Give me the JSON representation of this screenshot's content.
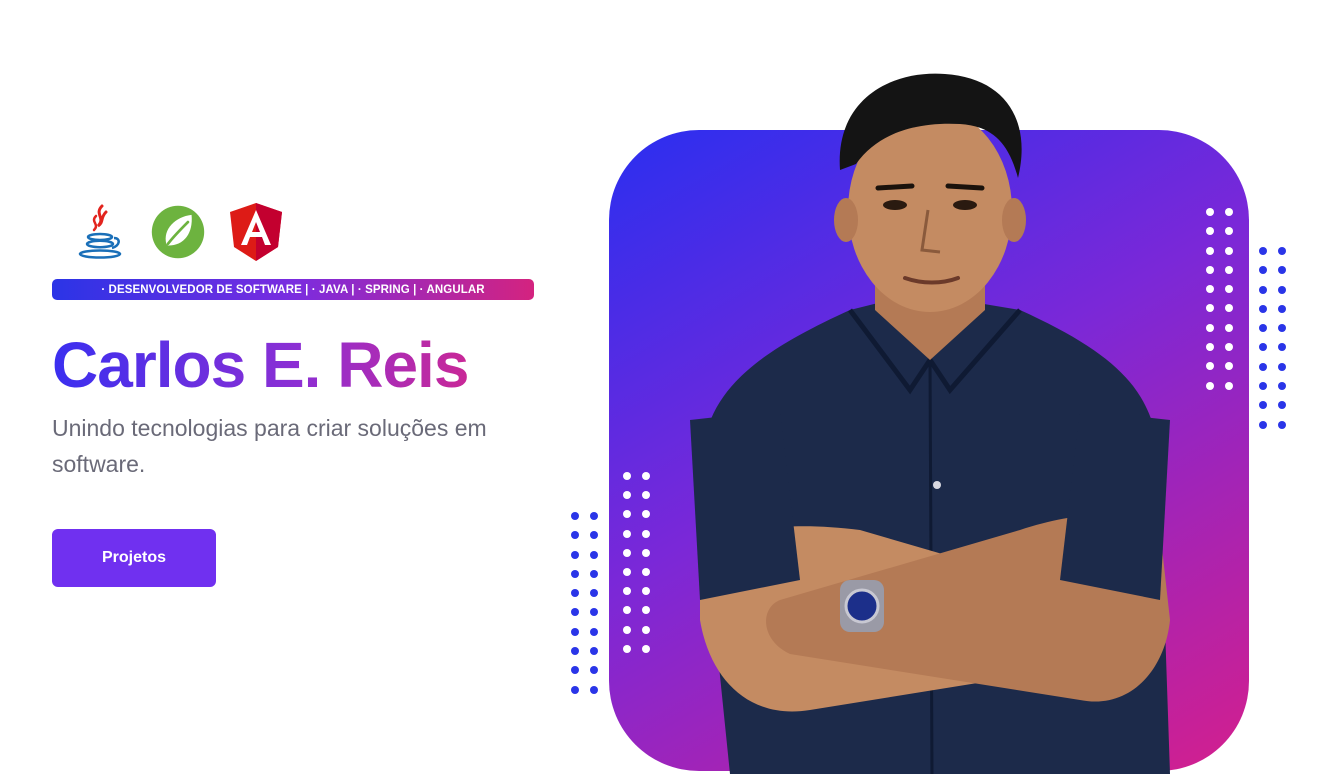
{
  "hero": {
    "tech_logos": [
      {
        "name": "java-logo-icon"
      },
      {
        "name": "spring-logo-icon"
      },
      {
        "name": "angular-logo-icon"
      }
    ],
    "tagline": "· DESENVOLVEDOR DE SOFTWARE | · JAVA | · SPRING | · ANGULAR",
    "name": "Carlos E. Reis",
    "subtitle": "Unindo tecnologias para criar soluções em software.",
    "cta_label": "Projetos"
  },
  "colors": {
    "accent": "#7030f0",
    "gradient_start": "#2a2ff0",
    "gradient_end": "#d41f8d",
    "dots_blue": "#2a35e8"
  }
}
